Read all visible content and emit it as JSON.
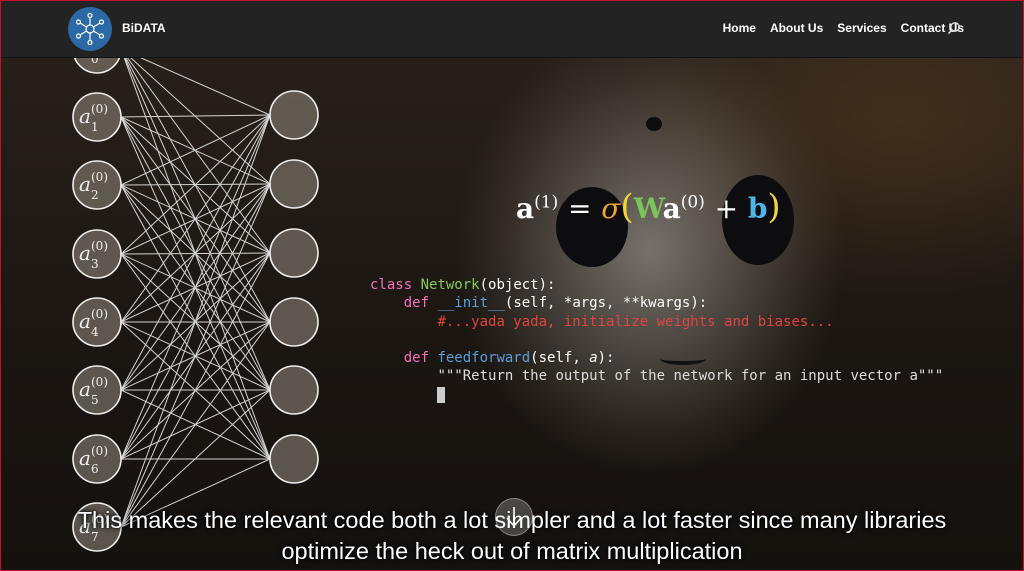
{
  "header": {
    "brand": "BiDATA",
    "nav": [
      {
        "label": "Home"
      },
      {
        "label": "About Us"
      },
      {
        "label": "Services"
      },
      {
        "label": "Contact Us"
      }
    ],
    "search_icon": "search-icon",
    "colors": {
      "bar": "#232323",
      "logo": "#2b6aa6"
    }
  },
  "network": {
    "inputs": [
      "0",
      "1",
      "2",
      "3",
      "4",
      "5",
      "6",
      "7"
    ],
    "superscript": "(0)"
  },
  "formula": {
    "lhs": "a",
    "lhs_sup": "(1)",
    "eq": "=",
    "sigma": "σ",
    "open": "(",
    "w": "W",
    "a": "a",
    "a_sup": "(0)",
    "plus": "+",
    "b": "b",
    "close": ")"
  },
  "code": {
    "l1_kw": "class",
    "l1_name": "Network",
    "l1_rest": "(object):",
    "l2_kw": "def",
    "l2_name": "__init__",
    "l2_rest": "(self, *args, **kwargs):",
    "l3_comment": "#...yada yada, initialize weights and biases...",
    "l4_kw": "def",
    "l4_name": "feedforward",
    "l4_rest": "(self, ",
    "l4_arg": "a",
    "l4_end": "):",
    "l5_doc": "\"\"\"Return the output of the network for an input vector a\"\"\""
  },
  "caption": {
    "line1": "This makes the relevant code both a lot simpler and a lot faster since many libraries",
    "line2": "optimize the heck out of matrix multiplication"
  }
}
